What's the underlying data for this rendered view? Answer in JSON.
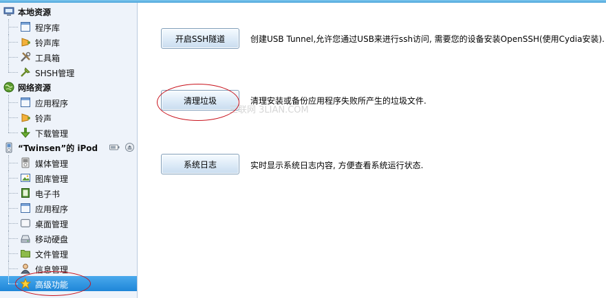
{
  "sidebar": {
    "local": {
      "label": "本地资源",
      "items": [
        {
          "label": "程序库",
          "icon": "app-library-icon"
        },
        {
          "label": "铃声库",
          "icon": "ringtone-library-icon"
        },
        {
          "label": "工具箱",
          "icon": "toolbox-icon"
        },
        {
          "label": "SHSH管理",
          "icon": "shsh-icon"
        }
      ]
    },
    "network": {
      "label": "网络资源",
      "items": [
        {
          "label": "应用程序",
          "icon": "applications-icon"
        },
        {
          "label": "铃声",
          "icon": "ringtone-icon"
        },
        {
          "label": "下载管理",
          "icon": "download-icon"
        }
      ]
    },
    "device": {
      "label": "“Twinsen”的 iPod",
      "items": [
        {
          "label": "媒体管理",
          "icon": "media-icon"
        },
        {
          "label": "图库管理",
          "icon": "gallery-icon"
        },
        {
          "label": "电子书",
          "icon": "ebook-icon"
        },
        {
          "label": "应用程序",
          "icon": "applications-icon"
        },
        {
          "label": "桌面管理",
          "icon": "desktop-icon"
        },
        {
          "label": "移动硬盘",
          "icon": "drive-icon"
        },
        {
          "label": "文件管理",
          "icon": "folder-icon"
        },
        {
          "label": "信息管理",
          "icon": "contacts-icon"
        },
        {
          "label": "高级功能",
          "icon": "star-icon"
        }
      ],
      "selected_index": 8
    }
  },
  "actions": [
    {
      "button": "开启SSH隧道",
      "description": "创建USB Tunnel,允许您通过USB来进行ssh访问, 需要您的设备安装OpenSSH(使用Cydia安装)."
    },
    {
      "button": "清理垃圾",
      "description": "清理安装或备份应用程序失败所产生的垃圾文件."
    },
    {
      "button": "系统日志",
      "description": "实时显示系统日志内容, 方便查看系统运行状态."
    }
  ],
  "watermark": "三联网 3LIAN.COM",
  "colors": {
    "sidebar_bg": "#eef3fa",
    "selection": "#1e86d8",
    "annotation": "#c8101a",
    "topbar": "#4aa3d9"
  }
}
